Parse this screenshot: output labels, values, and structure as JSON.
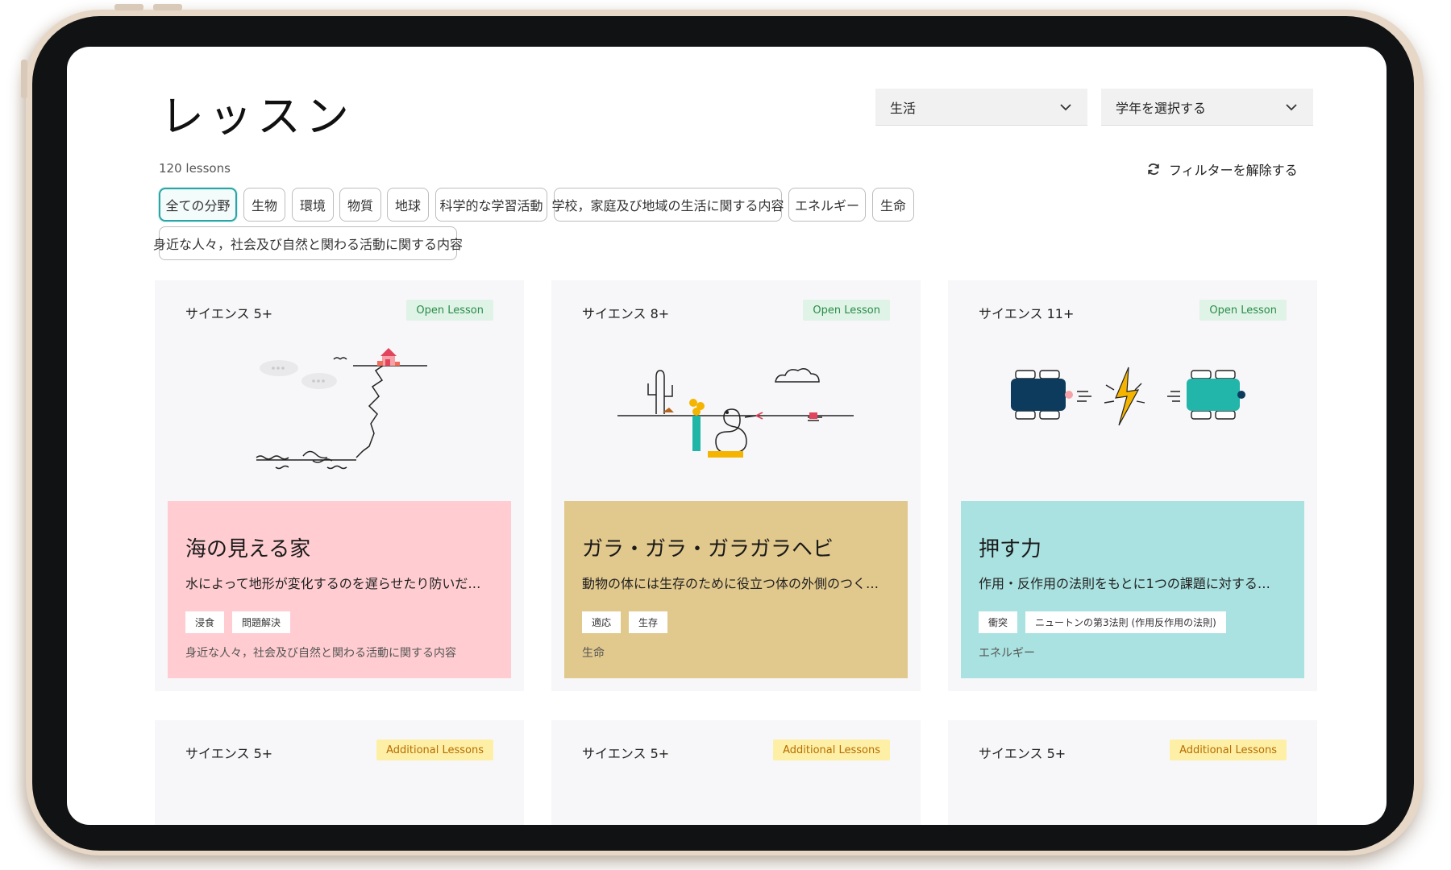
{
  "page": {
    "title": "レッスン",
    "lesson_count": "120 lessons",
    "subject_select": {
      "value": "生活"
    },
    "grade_select": {
      "value": "学年を選択する"
    },
    "reset_filters": "フィルターを解除する"
  },
  "filter_chips": [
    "全ての分野",
    "生物",
    "環境",
    "物質",
    "地球",
    "科学的な学習活動",
    "学校，家庭及び地域の生活に関する内容",
    "エネルギー",
    "生命",
    "身近な人々，社会及び自然と関わる活動に関する内容"
  ],
  "cards": [
    {
      "grade": "サイエンス 5+",
      "badge": "Open Lesson",
      "title": "海の見える家",
      "description": "水によって地形が変化するのを遅らせたり防いだ…",
      "tags": [
        "浸食",
        "問題解決"
      ],
      "category": "身近な人々，社会及び自然と関わる活動に関する内容",
      "panel_color": "#ffcdd1",
      "illustration": "seaside-cliff-house"
    },
    {
      "grade": "サイエンス 8+",
      "badge": "Open Lesson",
      "title": "ガラ・ガラ・ガラガラヘビ",
      "description": "動物の体には生存のために役立つ体の外側のつく…",
      "tags": [
        "適応",
        "生存"
      ],
      "category": "生命",
      "panel_color": "#e1c88c",
      "illustration": "desert-rattlesnake"
    },
    {
      "grade": "サイエンス 11+",
      "badge": "Open Lesson",
      "title": "押す力",
      "description": "作用・反作用の法則をもとに1つの課題に対する…",
      "tags": [
        "衝突",
        "ニュートンの第3法則 (作用反作用の法則)"
      ],
      "category": "エネルギー",
      "panel_color": "#a9e2e0",
      "illustration": "colliding-robot-cars"
    }
  ],
  "cards_row2": [
    {
      "grade": "サイエンス 5+",
      "badge": "Additional Lessons"
    },
    {
      "grade": "サイエンス 5+",
      "badge": "Additional Lessons"
    },
    {
      "grade": "サイエンス 5+",
      "badge": "Additional Lessons"
    }
  ],
  "colors": {
    "accent_teal": "#2aa5a5",
    "open_badge_bg": "#dff3e6",
    "additional_badge_bg": "#fdf0a6"
  }
}
